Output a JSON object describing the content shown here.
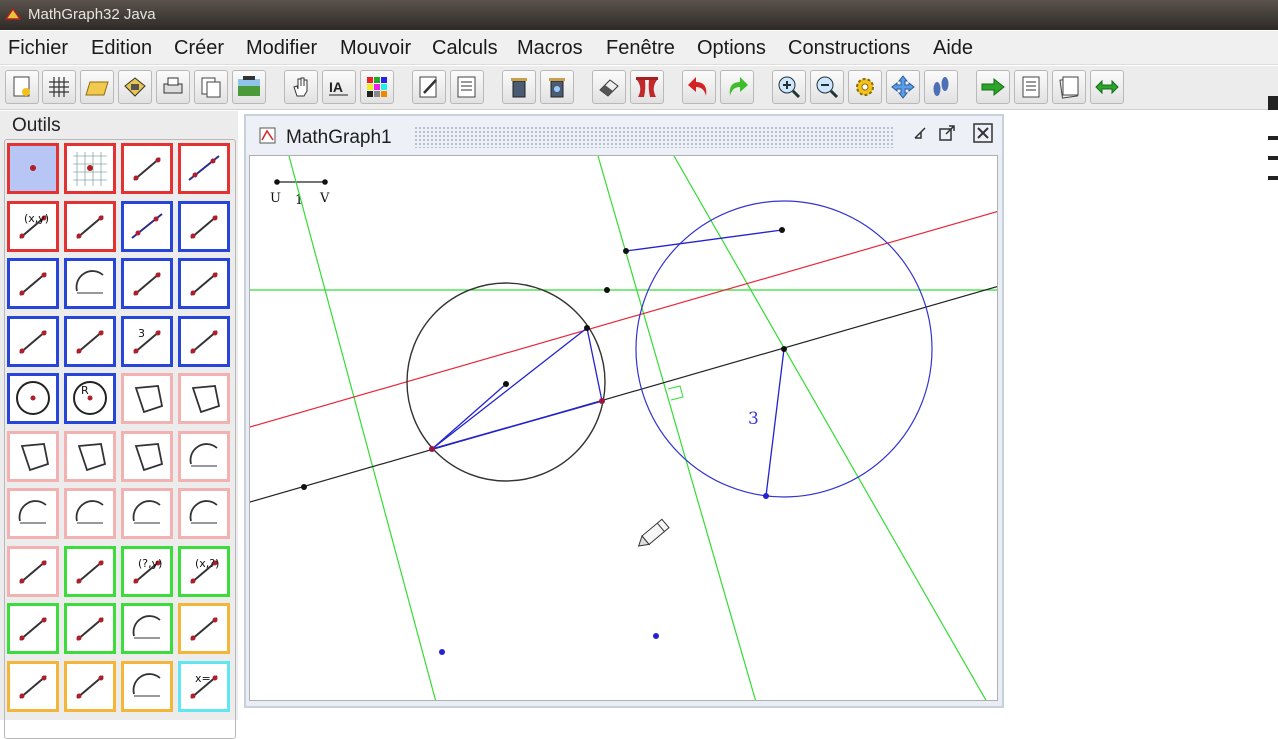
{
  "window": {
    "title": "MathGraph32 Java"
  },
  "menu": [
    "Fichier",
    "Edition",
    "Créer",
    "Modifier",
    "Mouvoir",
    "Calculs",
    "Macros",
    "Fenêtre",
    "Options",
    "Constructions",
    "Aide"
  ],
  "toolbar": {
    "buttons": [
      "new-figure-icon",
      "grid-icon",
      "open-folder-icon",
      "save-icon",
      "print-icon",
      "copy-icon",
      "image-export-icon",
      "hand-icon",
      "text-ia-icon",
      "palette-icon",
      "edit-icon",
      "list-icon",
      "trash-icon",
      "trash-all-icon",
      "eraser-icon",
      "curtain-icon",
      "undo-icon",
      "redo-icon",
      "zoom-in-icon",
      "zoom-out-icon",
      "settings-icon",
      "move-all-icon",
      "footprints-icon",
      "next-icon",
      "protocol-icon",
      "notes-icon",
      "swap-icon"
    ]
  },
  "outils": {
    "title": "Outils",
    "tools": [
      {
        "icon": "point-tool-icon",
        "color": "red"
      },
      {
        "icon": "point-on-grid-icon",
        "color": "red"
      },
      {
        "icon": "point-on-object-icon",
        "color": "red"
      },
      {
        "icon": "point-on-line-icon",
        "color": "red"
      },
      {
        "icon": "point-by-coordinates-icon",
        "color": "red",
        "label": "(x,y)"
      },
      {
        "icon": "intersection-icon",
        "color": "red"
      },
      {
        "icon": "line-icon",
        "color": "blue"
      },
      {
        "icon": "parallel-icon",
        "color": "blue"
      },
      {
        "icon": "perpendicular-icon",
        "color": "blue"
      },
      {
        "icon": "angle-bisector-icon",
        "color": "blue"
      },
      {
        "icon": "mediator-icon",
        "color": "blue"
      },
      {
        "icon": "midpoint-line-icon",
        "color": "blue"
      },
      {
        "icon": "vertical-line-icon",
        "color": "blue"
      },
      {
        "icon": "segment-icon",
        "color": "blue"
      },
      {
        "icon": "segment-length-icon",
        "color": "blue",
        "label": "3"
      },
      {
        "icon": "ray-icon",
        "color": "blue"
      },
      {
        "icon": "circle-center-point-icon",
        "color": "blue"
      },
      {
        "icon": "circle-center-radius-icon",
        "color": "blue",
        "label": "R"
      },
      {
        "icon": "polygon-icon",
        "color": "pink"
      },
      {
        "icon": "regular-polygon-icon",
        "color": "pink"
      },
      {
        "icon": "parallelogram-icon",
        "color": "pink"
      },
      {
        "icon": "square-icon",
        "color": "pink"
      },
      {
        "icon": "triangle-icon",
        "color": "pink"
      },
      {
        "icon": "arc-icon",
        "color": "pink"
      },
      {
        "icon": "arc-measure-icon",
        "color": "pink"
      },
      {
        "icon": "arc-direct-icon",
        "color": "pink"
      },
      {
        "icon": "arc-indirect-icon",
        "color": "pink"
      },
      {
        "icon": "angle-icon",
        "color": "pink"
      },
      {
        "icon": "segment-mark-icon",
        "color": "pink"
      },
      {
        "icon": "measure-length-icon",
        "color": "green"
      },
      {
        "icon": "measure-coords-icon",
        "color": "green",
        "label": "(?,y)"
      },
      {
        "icon": "measure-abscissa-icon",
        "color": "green",
        "label": "(x,?)"
      },
      {
        "icon": "measure-distance-icon",
        "color": "green"
      },
      {
        "icon": "measure-area-icon",
        "color": "green"
      },
      {
        "icon": "measure-angle-icon",
        "color": "green"
      },
      {
        "icon": "translation-icon",
        "color": "orange"
      },
      {
        "icon": "rotation-icon",
        "color": "orange"
      },
      {
        "icon": "homothety-icon",
        "color": "orange"
      },
      {
        "icon": "protractor-icon",
        "color": "orange"
      },
      {
        "icon": "calculation-icon",
        "color": "cyan",
        "label": "x="
      }
    ]
  },
  "document": {
    "title": "MathGraph1",
    "unit": {
      "u": "U",
      "v": "V",
      "length": "1"
    },
    "measure": "3"
  },
  "colors": {
    "red_line": "#e8283a",
    "green_line": "#33dd33",
    "blue": "#2323d0",
    "black": "#222222"
  }
}
